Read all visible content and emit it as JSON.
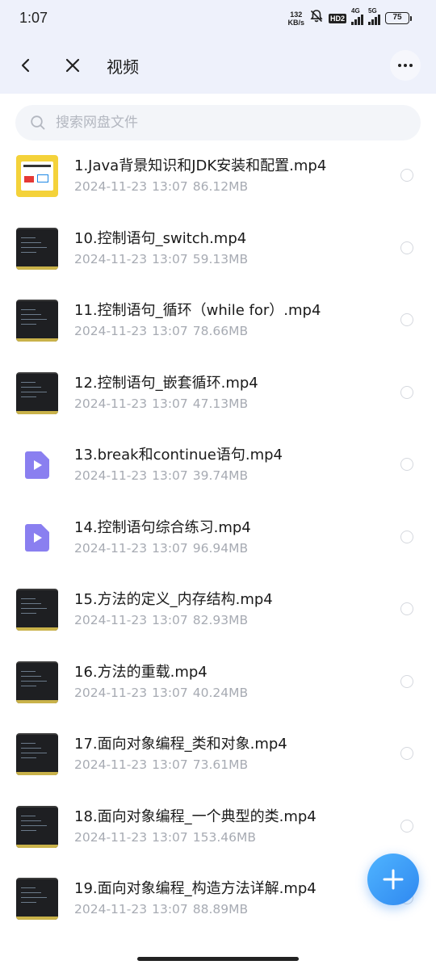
{
  "status_bar": {
    "time": "1:07",
    "net_speed_value": "132",
    "net_speed_unit": "KB/s",
    "hd_badge": "HD2",
    "signal1_label": "4G",
    "signal2_label": "5G",
    "battery": "75"
  },
  "header": {
    "title": "视频"
  },
  "search": {
    "placeholder": "搜索网盘文件"
  },
  "files": [
    {
      "name": "1.Java背景知识和JDK安装和配置.mp4",
      "date": "2024-11-23",
      "time": "13:07",
      "size": "86.12MB",
      "thumb": "slide"
    },
    {
      "name": "10.控制语句_switch.mp4",
      "date": "2024-11-23",
      "time": "13:07",
      "size": "59.13MB",
      "thumb": "code"
    },
    {
      "name": "11.控制语句_循环（while for）.mp4",
      "date": "2024-11-23",
      "time": "13:07",
      "size": "78.66MB",
      "thumb": "code"
    },
    {
      "name": "12.控制语句_嵌套循环.mp4",
      "date": "2024-11-23",
      "time": "13:07",
      "size": "47.13MB",
      "thumb": "code"
    },
    {
      "name": "13.break和continue语句.mp4",
      "date": "2024-11-23",
      "time": "13:07",
      "size": "39.74MB",
      "thumb": "video-icon"
    },
    {
      "name": "14.控制语句综合练习.mp4",
      "date": "2024-11-23",
      "time": "13:07",
      "size": "96.94MB",
      "thumb": "video-icon"
    },
    {
      "name": "15.方法的定义_内存结构.mp4",
      "date": "2024-11-23",
      "time": "13:07",
      "size": "82.93MB",
      "thumb": "code"
    },
    {
      "name": "16.方法的重载.mp4",
      "date": "2024-11-23",
      "time": "13:07",
      "size": "40.24MB",
      "thumb": "code"
    },
    {
      "name": "17.面向对象编程_类和对象.mp4",
      "date": "2024-11-23",
      "time": "13:07",
      "size": "73.61MB",
      "thumb": "code"
    },
    {
      "name": "18.面向对象编程_一个典型的类.mp4",
      "date": "2024-11-23",
      "time": "13:07",
      "size": "153.46MB",
      "thumb": "code"
    },
    {
      "name": "19.面向对象编程_构造方法详解.mp4",
      "date": "2024-11-23",
      "time": "13:07",
      "size": "88.89MB",
      "thumb": "code"
    }
  ],
  "colors": {
    "header_bg": "#eef1fb",
    "accent": "#2f88f0",
    "video_icon": "#8a7ff0"
  }
}
